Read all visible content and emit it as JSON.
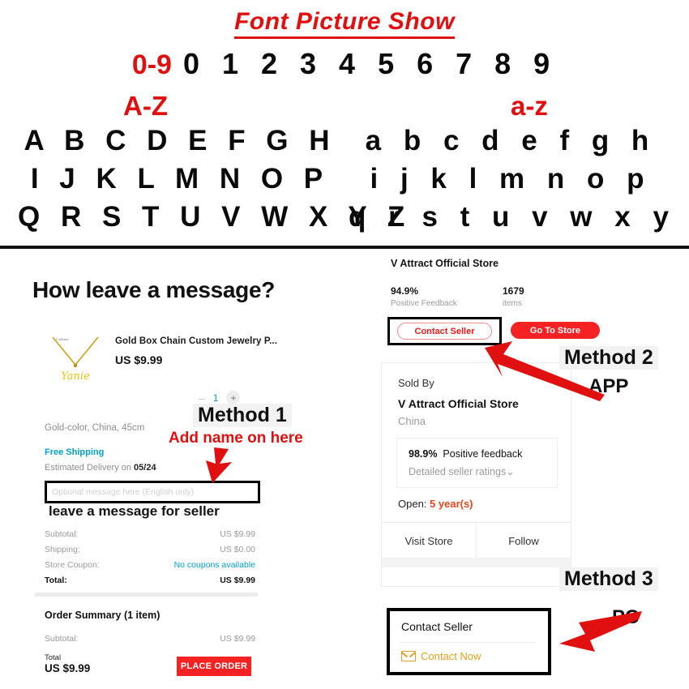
{
  "font_show": {
    "title": "Font Picture Show",
    "digits_label": "0-9",
    "digits": "0 1 2 3 4 5 6 7 8 9",
    "upper_label": "A-Z",
    "lower_label": "a-z",
    "upper_rows": [
      "A B C D E F G H",
      "I J K L M N O P",
      "Q R S T U V W X Y Z"
    ],
    "lower_rows": [
      "a b c d e f g h",
      "i j k l m n o p",
      "q r s t u v w x y z"
    ]
  },
  "left": {
    "heading": "How leave a message?",
    "product_title": "Gold Box Chain Custom Jewelry P...",
    "product_price": "US $9.99",
    "qty_minus": "–",
    "qty_value": "1",
    "qty_plus": "+",
    "variant": "Gold-color, China, 45cm",
    "free_shipping": "Free Shipping",
    "delivery_prefix": "Estimated Delivery on ",
    "delivery_date": "05/24",
    "message_placeholder": "Optional message here (English only)",
    "message_caption": "leave a message for seller",
    "summary": [
      {
        "label": "Subtotal:",
        "value": "US $9.99",
        "accent": false
      },
      {
        "label": "Shipping:",
        "value": "US $0.00",
        "accent": false
      },
      {
        "label": "Store Coupon:",
        "value": "No coupons available",
        "accent": true
      },
      {
        "label": "Total:",
        "value": "US $9.99",
        "accent": false
      }
    ],
    "order_summary_heading": "Order Summary (1 item)",
    "order_subtotal_label": "Subtotal:",
    "order_subtotal_value": "US $9.99",
    "bottom_total_label": "Total",
    "bottom_total_value": "US $9.99",
    "place_order": "PLACE ORDER"
  },
  "right": {
    "store_name": "V Attract Official Store",
    "feedback_value": "94.9%",
    "feedback_label": "Positive Feedback",
    "items_value": "1679",
    "items_label": "items",
    "contact_seller_btn": "Contact Seller",
    "go_to_store_btn": "Go To Store",
    "sold_by_label": "Sold By",
    "sold_by_store": "V Attract Official Store",
    "sold_by_country": "China",
    "positive_pct": "98.9%",
    "positive_text": "Positive feedback",
    "detailed_ratings": "Detailed seller ratings",
    "chevron": "⌄",
    "open_label": "Open: ",
    "open_years": "5 year(s)",
    "visit_store": "Visit Store",
    "follow": "Follow",
    "contact_panel_title": "Contact Seller",
    "contact_now": "Contact Now"
  },
  "annotations": {
    "method1": "Method 1",
    "method1_note": "Add name on here",
    "method2": "Method 2",
    "method2_sub": "APP",
    "method3": "Method 3",
    "method3_sub": "PC"
  },
  "colors": {
    "red": "#e01010",
    "button_red": "#f42222",
    "teal": "#00a0c6",
    "gold": "#e0a020",
    "grey_text": "#9b9b9b"
  }
}
